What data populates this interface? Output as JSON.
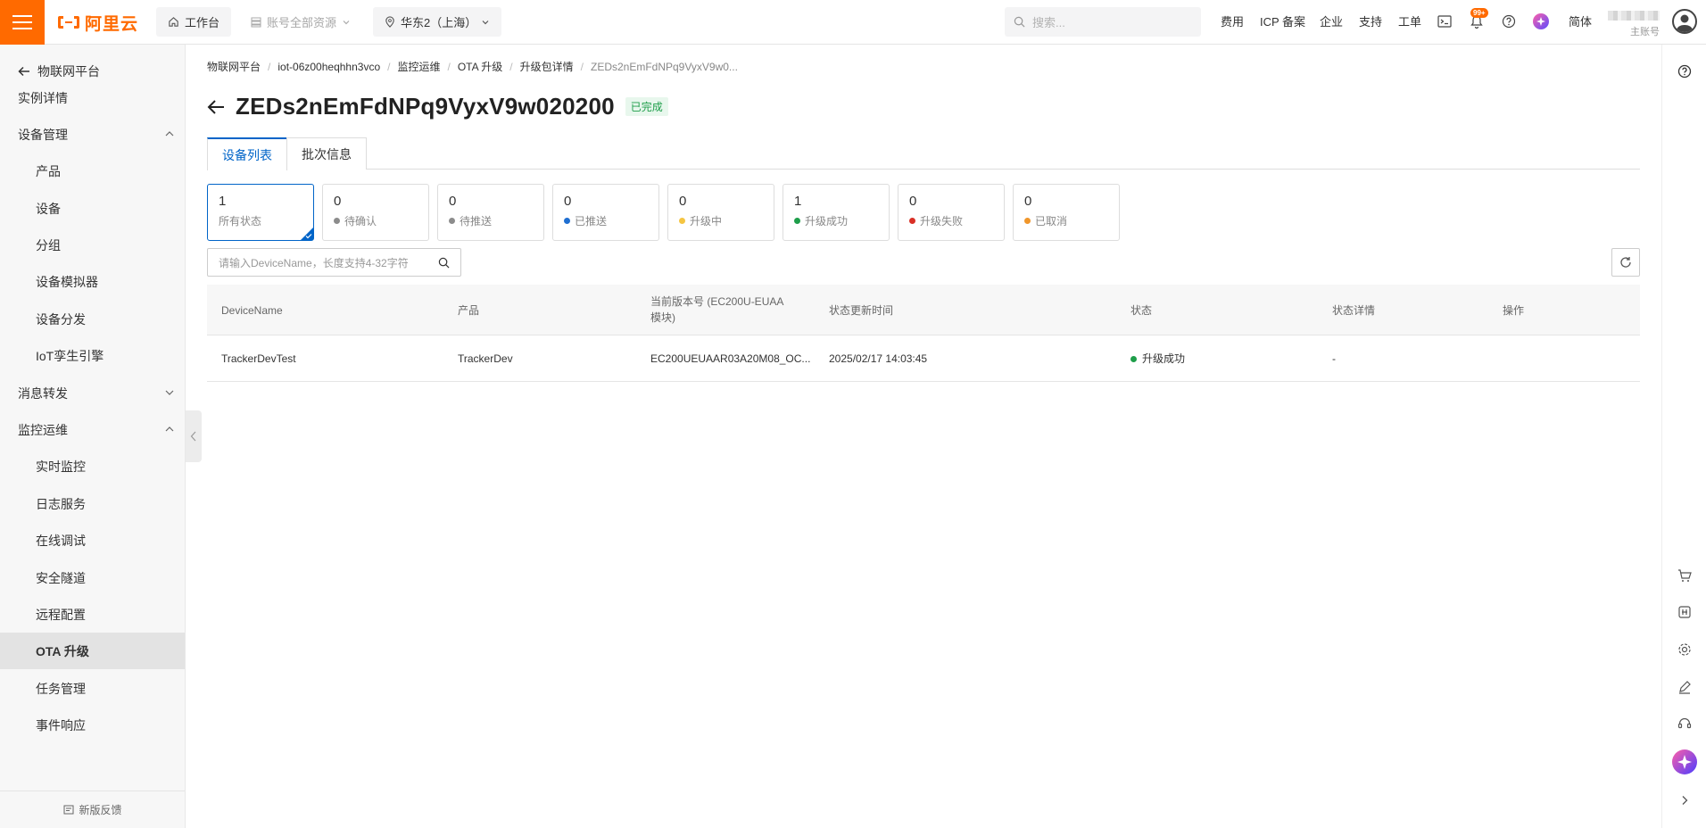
{
  "topbar": {
    "logo_text": "阿里云",
    "workbench": "工作台",
    "resources": "账号全部资源",
    "region": "华东2（上海）",
    "search_placeholder": "搜索...",
    "links": [
      "费用",
      "ICP 备案",
      "企业",
      "支持",
      "工单"
    ],
    "notification_badge": "99+",
    "lang": "简体",
    "account_sub": "主账号",
    "accent": "#ff6a00"
  },
  "sidebar": {
    "back_label": "物联网平台",
    "items": [
      {
        "label": "实例详情",
        "level": 1
      },
      {
        "label": "设备管理",
        "level": 1,
        "chevron": "up"
      },
      {
        "label": "产品",
        "level": 2
      },
      {
        "label": "设备",
        "level": 2
      },
      {
        "label": "分组",
        "level": 2
      },
      {
        "label": "设备模拟器",
        "level": 2
      },
      {
        "label": "设备分发",
        "level": 2
      },
      {
        "label": "IoT孪生引擎",
        "level": 2
      },
      {
        "label": "消息转发",
        "level": 1,
        "chevron": "down"
      },
      {
        "label": "监控运维",
        "level": 1,
        "chevron": "up"
      },
      {
        "label": "实时监控",
        "level": 2
      },
      {
        "label": "日志服务",
        "level": 2
      },
      {
        "label": "在线调试",
        "level": 2
      },
      {
        "label": "安全隧道",
        "level": 2
      },
      {
        "label": "远程配置",
        "level": 2
      },
      {
        "label": "OTA 升级",
        "level": 2,
        "active": true
      },
      {
        "label": "任务管理",
        "level": 2
      },
      {
        "label": "事件响应",
        "level": 2
      }
    ],
    "feedback": "新版反馈"
  },
  "breadcrumb": [
    "物联网平台",
    "iot-06z00heqhhn3vco",
    "监控运维",
    "OTA 升级",
    "升级包详情",
    "ZEDs2nEmFdNPq9VyxV9w0..."
  ],
  "page": {
    "title": "ZEDs2nEmFdNPq9VyxV9w020200",
    "status": "已完成"
  },
  "tabs": [
    "设备列表",
    "批次信息"
  ],
  "stats": [
    {
      "count": "1",
      "label": "所有状态",
      "color": ""
    },
    {
      "count": "0",
      "label": "待确认",
      "color": "#8c8c8c"
    },
    {
      "count": "0",
      "label": "待推送",
      "color": "#8c8c8c"
    },
    {
      "count": "0",
      "label": "已推送",
      "color": "#1f6fd1"
    },
    {
      "count": "0",
      "label": "升级中",
      "color": "#f5c542"
    },
    {
      "count": "1",
      "label": "升级成功",
      "color": "#1e9e4a"
    },
    {
      "count": "0",
      "label": "升级失败",
      "color": "#d93026"
    },
    {
      "count": "0",
      "label": "已取消",
      "color": "#f0962b"
    }
  ],
  "search": {
    "placeholder": "请输入DeviceName，长度支持4-32字符"
  },
  "table": {
    "headers": [
      "DeviceName",
      "产品",
      "当前版本号 (EC200U-EUAA 模块)",
      "状态更新时间",
      "状态",
      "状态详情",
      "操作"
    ],
    "rows": [
      [
        "TrackerDevTest",
        "TrackerDev",
        "EC200UEUAAR03A20M08_OC...",
        "2025/02/17 14:03:45",
        "升级成功",
        "-",
        ""
      ]
    ]
  }
}
